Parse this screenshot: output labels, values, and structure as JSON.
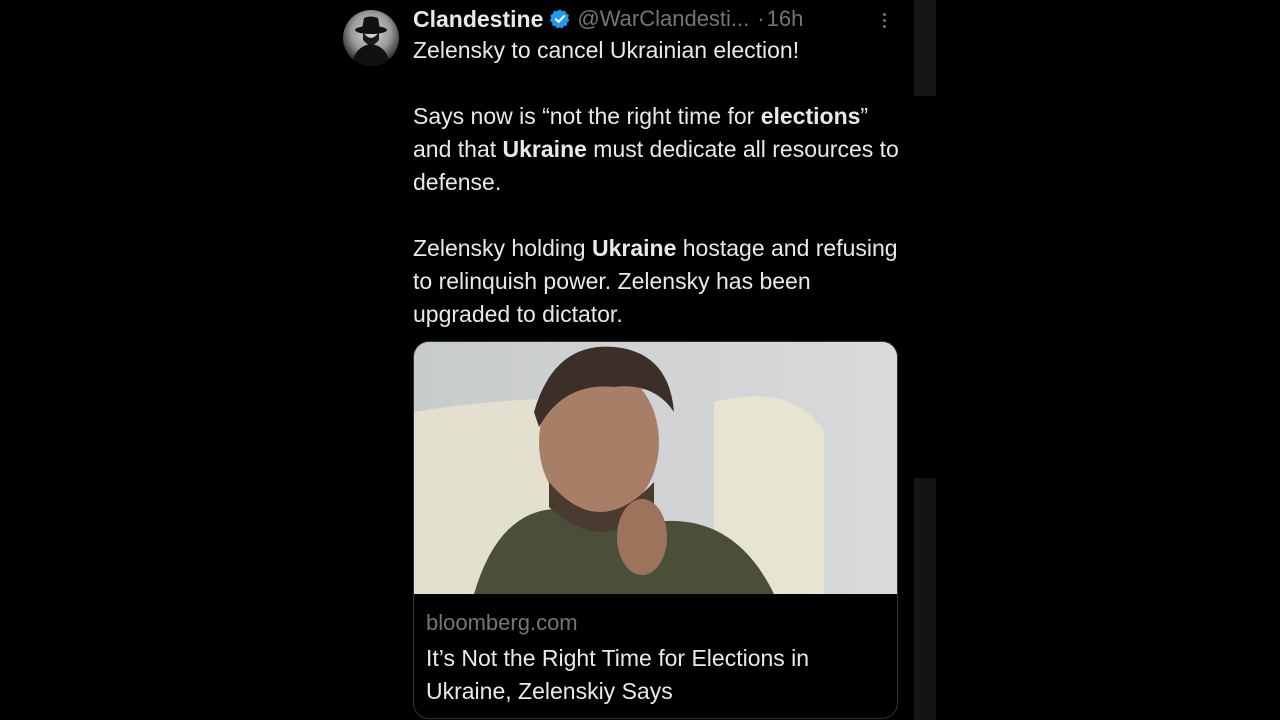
{
  "tweet": {
    "author_name": "Clandestine",
    "author_handle": "@WarClandesti...",
    "separator": "·",
    "time": "16h",
    "line1": "Zelensky to cancel Ukrainian election!",
    "para2_a": "Says now is “not the right time for ",
    "para2_b": "elections",
    "para2_c": "” and that ",
    "para2_d": "Ukraine",
    "para2_e": " must dedicate all resources to defense.",
    "para3_a": "Zelensky holding ",
    "para3_b": "Ukraine",
    "para3_c": " hostage and refusing to relinquish power. Zelensky has been upgraded to dictator."
  },
  "card": {
    "domain": "bloomberg.com",
    "title": "It’s Not the Right Time for Elections in Ukraine, Zelenskiy Says"
  },
  "colors": {
    "background": "#000000",
    "text": "#e7e9ea",
    "muted": "#71767b",
    "verified": "#1d9bf0"
  }
}
